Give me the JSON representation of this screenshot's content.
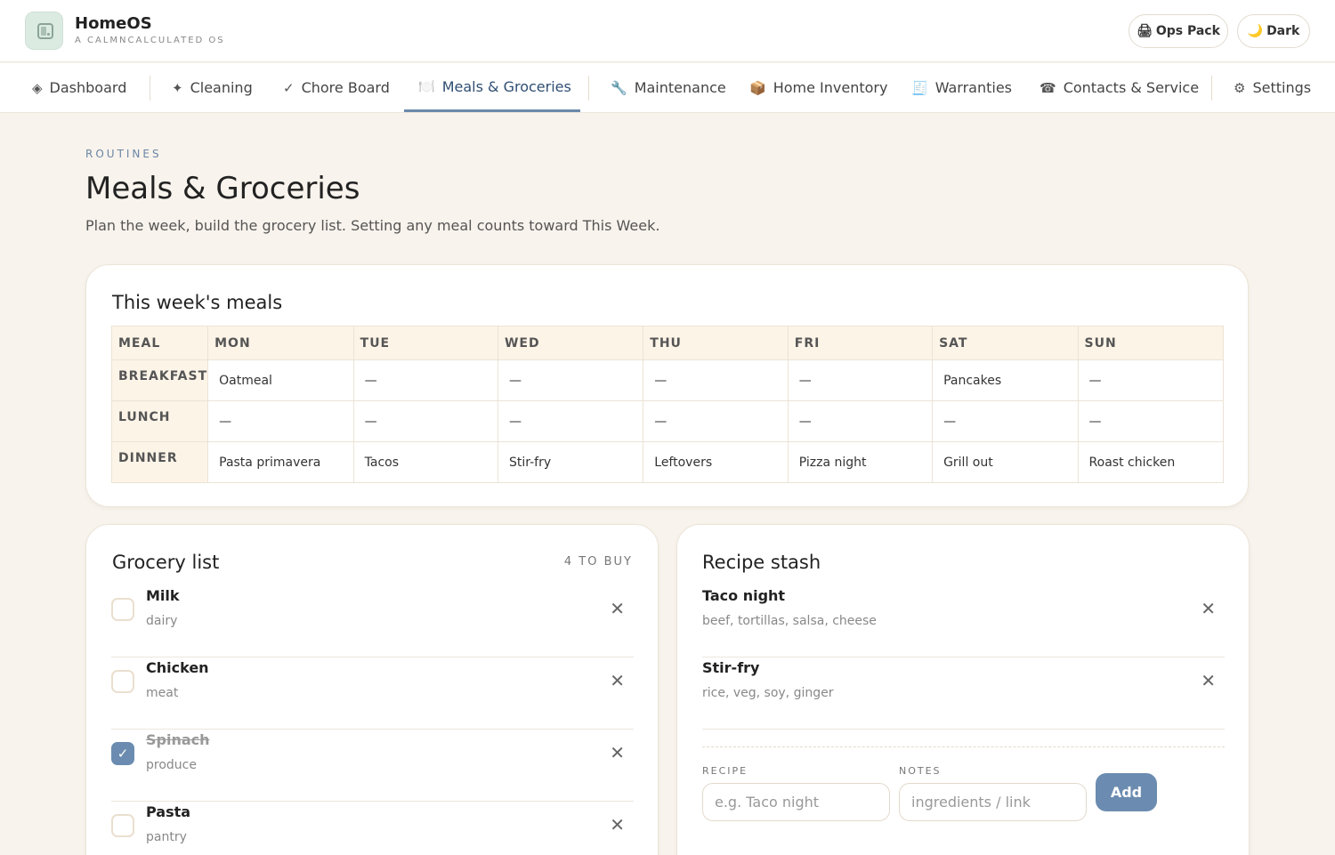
{
  "app": {
    "name": "HomeOS",
    "tagline": "A CALMNCALCULATED OS"
  },
  "header_buttons": {
    "ops_pack": "Ops Pack",
    "dark": "Dark"
  },
  "nav": [
    {
      "label": "Dashboard",
      "icon": "◈"
    },
    {
      "label": "Cleaning",
      "icon": "✦"
    },
    {
      "label": "Chore Board",
      "icon": "✓"
    },
    {
      "label": "Meals & Groceries",
      "icon": "🍽️"
    },
    {
      "label": "Maintenance",
      "icon": "🔧"
    },
    {
      "label": "Home Inventory",
      "icon": "📦"
    },
    {
      "label": "Warranties",
      "icon": "🧾"
    },
    {
      "label": "Contacts & Service",
      "icon": "☎"
    },
    {
      "label": "Settings",
      "icon": "⚙"
    }
  ],
  "page": {
    "eyebrow": "ROUTINES",
    "title": "Meals & Groceries",
    "subtitle": "Plan the week, build the grocery list. Setting any meal counts toward This Week."
  },
  "meals": {
    "title": "This week's meals",
    "headers": [
      "MEAL",
      "MON",
      "TUE",
      "WED",
      "THU",
      "FRI",
      "SAT",
      "SUN"
    ],
    "rows": [
      {
        "meal": "BREAKFAST",
        "days": [
          "Oatmeal",
          "—",
          "—",
          "—",
          "—",
          "Pancakes",
          "—"
        ]
      },
      {
        "meal": "LUNCH",
        "days": [
          "—",
          "—",
          "—",
          "—",
          "—",
          "—",
          "—"
        ]
      },
      {
        "meal": "DINNER",
        "days": [
          "Pasta primavera",
          "Tacos",
          "Stir-fry",
          "Leftovers",
          "Pizza night",
          "Grill out",
          "Roast chicken"
        ]
      }
    ]
  },
  "grocery": {
    "title": "Grocery list",
    "count": "4 TO BUY",
    "items": [
      {
        "name": "Milk",
        "category": "dairy",
        "checked": false
      },
      {
        "name": "Chicken",
        "category": "meat",
        "checked": false
      },
      {
        "name": "Spinach",
        "category": "produce",
        "checked": true
      },
      {
        "name": "Pasta",
        "category": "pantry",
        "checked": false
      }
    ]
  },
  "recipes": {
    "title": "Recipe stash",
    "items": [
      {
        "name": "Taco night",
        "notes": "beef, tortillas, salsa, cheese"
      },
      {
        "name": "Stir-fry",
        "notes": "rice, veg, soy, ginger"
      }
    ],
    "form": {
      "recipe_label": "RECIPE",
      "recipe_placeholder": "e.g. Taco night",
      "notes_label": "NOTES",
      "notes_placeholder": "ingredients / link",
      "add_label": "Add"
    }
  },
  "colors": {
    "accent": "#6b8cb0",
    "background": "#f8f3ec",
    "table_header": "#fdf4e8"
  },
  "icons": {
    "remove": "✕",
    "check": "✓",
    "ops_pack": "🖨",
    "dark": "🌙"
  }
}
